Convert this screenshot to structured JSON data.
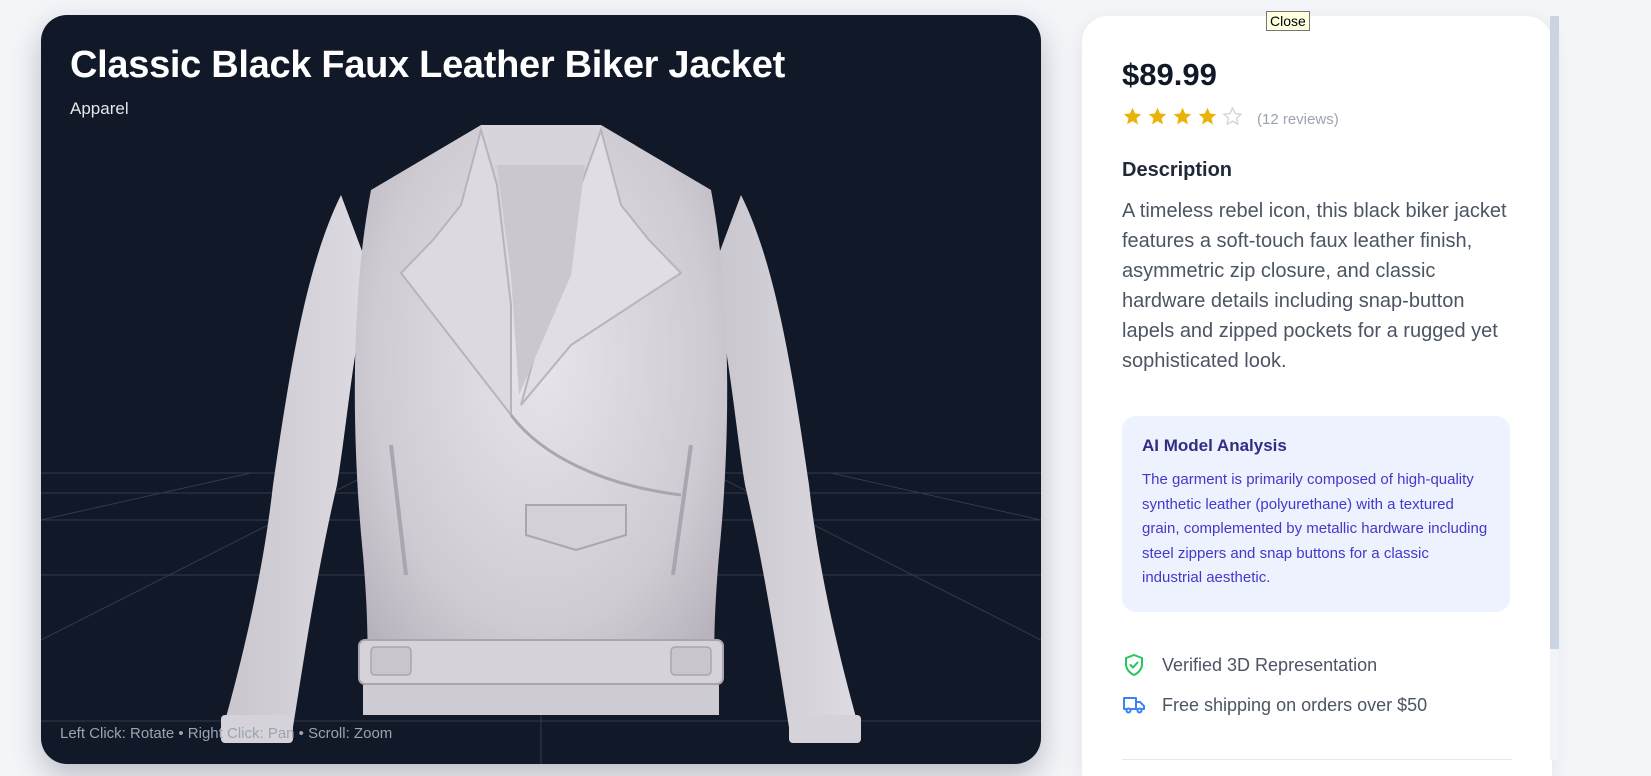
{
  "product": {
    "title": "Classic Black Faux Leather Biker Jacket",
    "category": "Apparel",
    "price": "$89.99",
    "rating": 4,
    "rating_max": 5,
    "reviews_label": "(12 reviews)"
  },
  "viewer": {
    "help_text": "Left Click: Rotate • Right Click: Pan • Scroll: Zoom"
  },
  "description": {
    "heading": "Description",
    "text": "A timeless rebel icon, this black biker jacket features a soft-touch faux leather finish, asymmetric zip closure, and classic hardware details including snap-button lapels and zipped pockets for a rugged yet sophisticated look."
  },
  "ai_analysis": {
    "title": "AI Model Analysis",
    "text": "The garment is primarily composed of high-quality synthetic leather (polyurethane) with a textured grain, complemented by metallic hardware including steel zippers and snap buttons for a classic industrial aesthetic."
  },
  "features": [
    {
      "icon": "shield-check-icon",
      "label": "Verified 3D Representation",
      "color": "#22c55e"
    },
    {
      "icon": "truck-icon",
      "label": "Free shipping on orders over $50",
      "color": "#3b82f6"
    }
  ],
  "tooltip": {
    "label": "Close"
  },
  "colors": {
    "viewer_bg": "#111827",
    "star_filled": "#eab308",
    "star_empty": "#d1d5db",
    "ai_box_bg": "#eef2ff"
  }
}
